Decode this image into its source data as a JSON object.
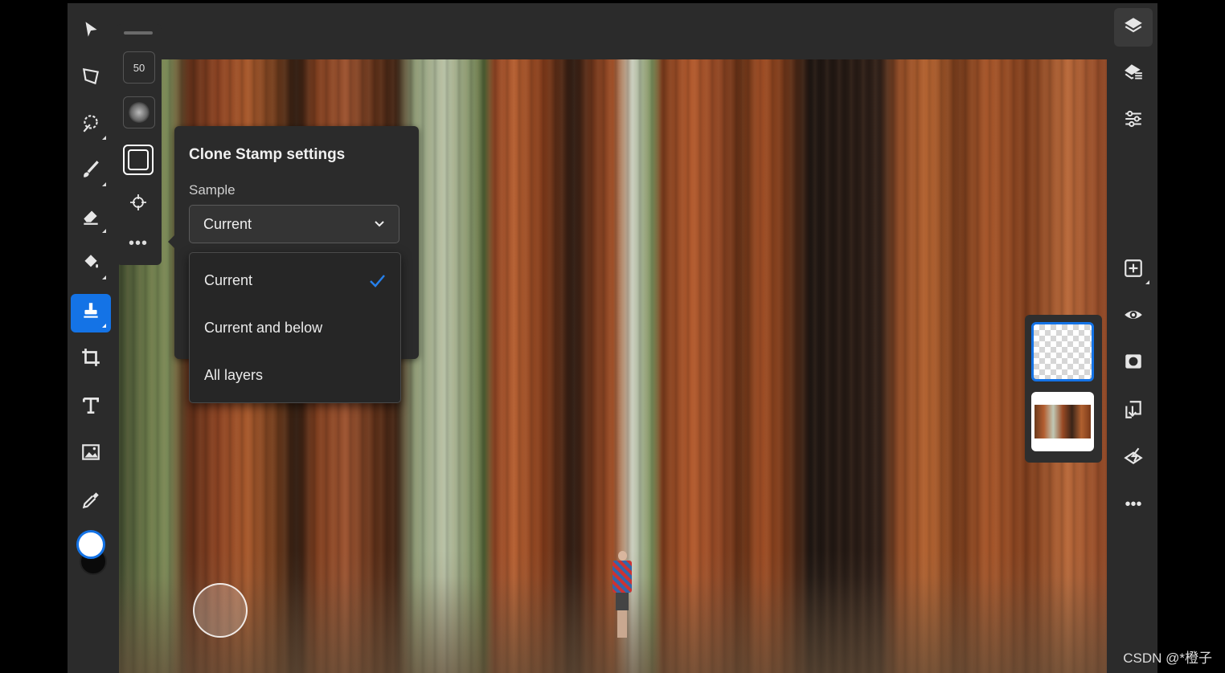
{
  "tool_options": {
    "brush_size": "50"
  },
  "panel": {
    "title": "Clone Stamp settings",
    "sample_label": "Sample",
    "sample_selected": "Current",
    "options": [
      {
        "label": "Current",
        "checked": true
      },
      {
        "label": "Current and below",
        "checked": false
      },
      {
        "label": "All layers",
        "checked": false
      }
    ]
  },
  "colors": {
    "accent": "#1473e6",
    "panel_bg": "#2b2b2b",
    "foreground_color": "#ffffff",
    "background_color": "#0a0a0a"
  },
  "watermark": "CSDN @*橙子"
}
